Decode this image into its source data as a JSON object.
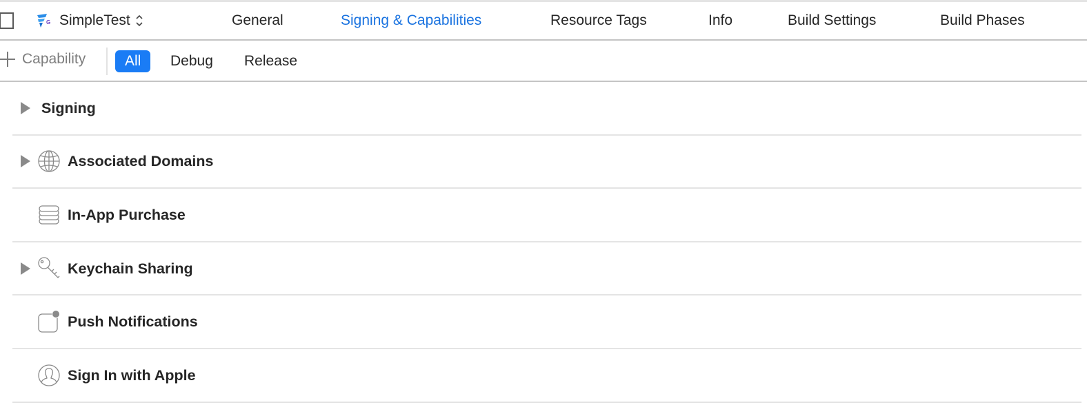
{
  "header": {
    "target_name": "SimpleTest",
    "tabs": [
      {
        "label": "General",
        "active": false
      },
      {
        "label": "Signing & Capabilities",
        "active": true
      },
      {
        "label": "Resource Tags",
        "active": false
      },
      {
        "label": "Info",
        "active": false
      },
      {
        "label": "Build Settings",
        "active": false
      },
      {
        "label": "Build Phases",
        "active": false
      }
    ]
  },
  "filterbar": {
    "add_capability_label": "Capability",
    "configurations": [
      {
        "label": "All",
        "active": true
      },
      {
        "label": "Debug",
        "active": false
      },
      {
        "label": "Release",
        "active": false
      }
    ]
  },
  "capabilities": [
    {
      "title": "Signing",
      "icon": "none",
      "expandable": true
    },
    {
      "title": "Associated Domains",
      "icon": "globe-icon",
      "expandable": true
    },
    {
      "title": "In-App Purchase",
      "icon": "coins-icon",
      "expandable": false
    },
    {
      "title": "Keychain Sharing",
      "icon": "key-icon",
      "expandable": true
    },
    {
      "title": "Push Notifications",
      "icon": "notification-badge-icon",
      "expandable": false
    },
    {
      "title": "Sign In with Apple",
      "icon": "person-circle-icon",
      "expandable": false
    }
  ],
  "colors": {
    "accent": "#1a7cf5",
    "active_tab_text": "#1a73e0",
    "text": "#262626",
    "muted_text": "#7d7d7d",
    "separator": "#e4e4e4"
  }
}
